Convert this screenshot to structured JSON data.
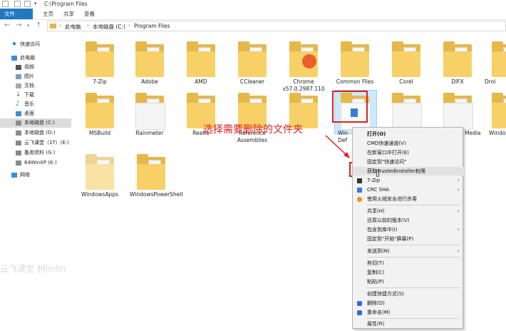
{
  "window": {
    "path_title": "C:\\Program Files",
    "ribbon_tabs": [
      "文件",
      "主页",
      "共享",
      "查看"
    ]
  },
  "address": {
    "crumbs": [
      "此电脑",
      "本地磁盘 (C:)",
      "Program Files"
    ]
  },
  "sidebar": {
    "items": [
      {
        "label": "快速访问",
        "icon": "star-icon"
      },
      {
        "label": "此电脑",
        "icon": "computer-icon"
      },
      {
        "label": "视频",
        "icon": "video-icon"
      },
      {
        "label": "图片",
        "icon": "picture-icon"
      },
      {
        "label": "文档",
        "icon": "document-icon"
      },
      {
        "label": "下载",
        "icon": "download-icon"
      },
      {
        "label": "音乐",
        "icon": "music-icon"
      },
      {
        "label": "桌面",
        "icon": "desktop-icon"
      },
      {
        "label": "本地磁盘 (C:)",
        "icon": "drive-icon"
      },
      {
        "label": "本地磁盘 (D:)",
        "icon": "drive-icon"
      },
      {
        "label": "云飞课堂（1T）(E:)",
        "icon": "drive-icon"
      },
      {
        "label": "备用资料 (G:)",
        "icon": "drive-icon"
      },
      {
        "label": "64WinXP (K:)",
        "icon": "drive-icon"
      },
      {
        "label": "网络",
        "icon": "network-icon"
      }
    ]
  },
  "folders": [
    {
      "name": "7-Zip"
    },
    {
      "name": "Adobe"
    },
    {
      "name": "AMD"
    },
    {
      "name": "CCleaner"
    },
    {
      "name": "Chrome v57.0.2987.110"
    },
    {
      "name": "Common Files"
    },
    {
      "name": "Corel"
    },
    {
      "name": "DIFX"
    },
    {
      "name": "Droi"
    },
    {
      "name": "MSBuild"
    },
    {
      "name": "Rainmeter"
    },
    {
      "name": "Realte"
    },
    {
      "name": "Reference Assemblies"
    },
    {
      "name": ""
    },
    {
      "name": "Win Def"
    },
    {
      "name": ""
    },
    {
      "name": "Media"
    },
    {
      "name": "Windo"
    },
    {
      "name": "WindowsApps"
    },
    {
      "name": "WindowsPowerShell"
    }
  ],
  "annotation": "选择需要删除的文件夹",
  "context_menu": {
    "items": [
      {
        "label": "打开(O)"
      },
      {
        "label": "CMD快速通道(V)"
      },
      {
        "label": "在新窗口中打开(E)"
      },
      {
        "label": "固定到\"快速访问\""
      },
      {
        "label": "获取TrustedInstaller权限"
      },
      {
        "label": "7-Zip"
      },
      {
        "label": "CRC SHA"
      },
      {
        "label": "使用火绒安全进行杀毒"
      },
      {
        "label": "共享(H)"
      },
      {
        "label": "还原以前的版本(V)"
      },
      {
        "label": "包含到库中(I)"
      },
      {
        "label": "固定到\"开始\"屏幕(P)"
      },
      {
        "label": "发送到(N)"
      },
      {
        "label": "剪切(T)"
      },
      {
        "label": "复制(C)"
      },
      {
        "label": "粘贴(P)"
      },
      {
        "label": "创建快捷方式(S)"
      },
      {
        "label": "删除(D)"
      },
      {
        "label": "重命名(M)"
      },
      {
        "label": "属性(R)"
      }
    ]
  },
  "watermark": {
    "top": "云飞课堂",
    "bottom": "云飞课堂 柯linlin"
  },
  "colors": {
    "accent": "#1979ca",
    "highlight": "#e02020",
    "selection": "#cce8ff",
    "folder": "#f7d068"
  }
}
